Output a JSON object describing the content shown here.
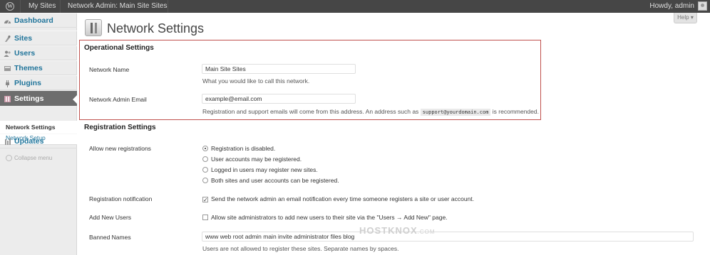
{
  "admin_bar": {
    "my_sites": "My Sites",
    "network_admin": "Network Admin: Main Site Sites",
    "howdy": "Howdy, admin"
  },
  "sidebar": {
    "items": [
      {
        "label": "Dashboard",
        "icon": "dashboard-icon"
      },
      {
        "label": "Sites",
        "icon": "sites-icon"
      },
      {
        "label": "Users",
        "icon": "users-icon"
      },
      {
        "label": "Themes",
        "icon": "themes-icon"
      },
      {
        "label": "Plugins",
        "icon": "plugins-icon"
      },
      {
        "label": "Settings",
        "icon": "settings-icon"
      },
      {
        "label": "Updates",
        "icon": "updates-icon"
      }
    ],
    "submenu": [
      "Network Settings",
      "Network Setup"
    ],
    "collapse": "Collapse menu"
  },
  "page": {
    "title": "Network Settings",
    "help": "Help ▾"
  },
  "operational": {
    "heading": "Operational Settings",
    "network_name_label": "Network Name",
    "network_name_value": "Main Site Sites",
    "network_name_desc": "What you would like to call this network.",
    "admin_email_label": "Network Admin Email",
    "admin_email_value": "example@email.com",
    "admin_email_desc_pre": "Registration and support emails will come from this address. An address such as",
    "admin_email_desc_code": "support@yourdomain.com",
    "admin_email_desc_post": "is recommended."
  },
  "registration": {
    "heading": "Registration Settings",
    "allow_label": "Allow new registrations",
    "options": [
      "Registration is disabled.",
      "User accounts may be registered.",
      "Logged in users may register new sites.",
      "Both sites and user accounts can be registered."
    ],
    "selected_option": 0,
    "notification_label": "Registration notification",
    "notification_text": "Send the network admin an email notification every time someone registers a site or user account.",
    "notification_checked": true,
    "add_users_label": "Add New Users",
    "add_users_text": "Allow site administrators to add new users to their site via the \"Users → Add New\" page.",
    "add_users_checked": false,
    "banned_label": "Banned Names",
    "banned_value": "www web root admin main invite administrator files blog",
    "banned_desc": "Users are not allowed to register these sites. Separate names by spaces."
  },
  "watermark": "HOSTKNOX",
  "watermark_suffix": ".COM"
}
